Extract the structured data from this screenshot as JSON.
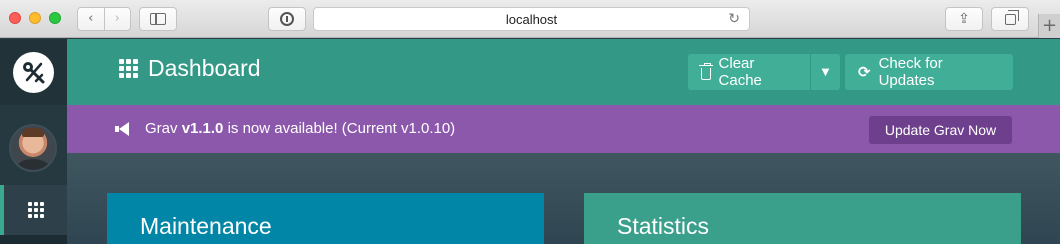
{
  "browser": {
    "url": "localhost",
    "nav_back": "‹",
    "nav_forward": "›",
    "reload_glyph": "↻",
    "share_glyph": "⇪",
    "new_tab": "+"
  },
  "sidebar": {
    "collapse_glyph": "»",
    "active_item": "dashboard"
  },
  "header": {
    "title": "Dashboard",
    "clear_cache_label": "Clear Cache",
    "cache_dropdown_glyph": "▼",
    "check_updates_label": "Check for Updates",
    "refresh_glyph": "⟳"
  },
  "notice": {
    "prefix": "Grav ",
    "version": "v1.1.0",
    "suffix": " is now available! (Current v1.0.10)",
    "button_label": "Update Grav Now"
  },
  "cards": {
    "maintenance_title": "Maintenance",
    "statistics_title": "Statistics"
  },
  "colors": {
    "accent_teal": "#349886",
    "notice_purple": "#8c58ab",
    "maintenance_blue": "#0286a7",
    "statistics_green": "#3aa08b"
  }
}
